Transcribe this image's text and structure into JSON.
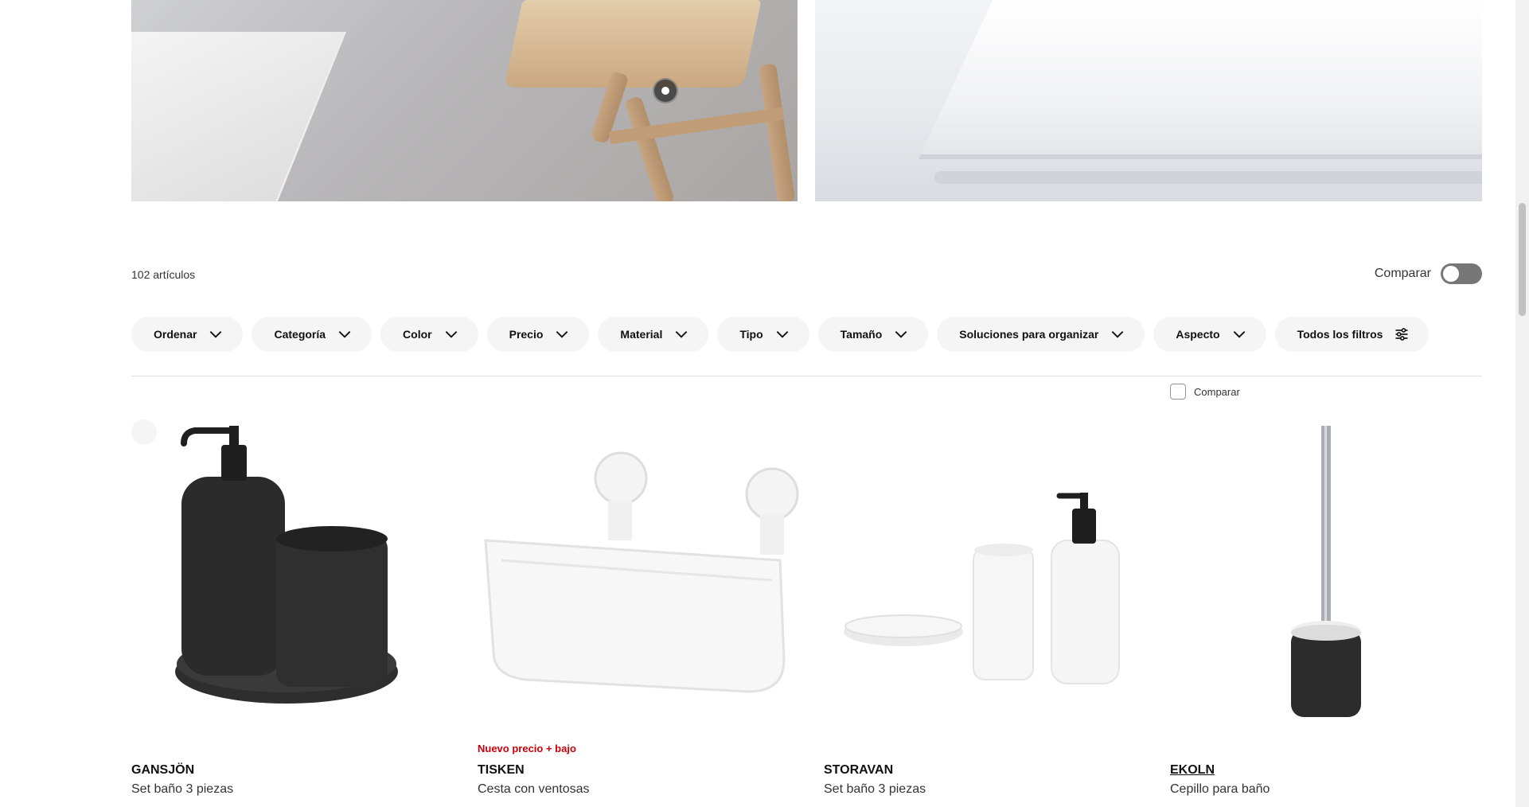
{
  "listing": {
    "count_label": "102 artículos",
    "compare_label": "Comparar"
  },
  "filters": [
    {
      "label": "Ordenar",
      "icon": "chevron-down-icon"
    },
    {
      "label": "Categoría",
      "icon": "chevron-down-icon"
    },
    {
      "label": "Color",
      "icon": "chevron-down-icon"
    },
    {
      "label": "Precio",
      "icon": "chevron-down-icon"
    },
    {
      "label": "Material",
      "icon": "chevron-down-icon"
    },
    {
      "label": "Tipo",
      "icon": "chevron-down-icon"
    },
    {
      "label": "Tamaño",
      "icon": "chevron-down-icon"
    },
    {
      "label": "Soluciones para organizar",
      "icon": "chevron-down-icon"
    },
    {
      "label": "Aspecto",
      "icon": "chevron-down-icon"
    },
    {
      "label": "Todos los filtros",
      "icon": "sliders-icon"
    }
  ],
  "products": [
    {
      "name": "GANSJÖN",
      "description": "Set baño 3 piezas",
      "badge": ""
    },
    {
      "name": "TISKEN",
      "description": "Cesta con ventosas",
      "badge": "Nuevo precio + bajo"
    },
    {
      "name": "STORAVAN",
      "description": "Set baño 3 piezas",
      "badge": ""
    },
    {
      "name": "EKOLN",
      "description": "Cepillo para baño",
      "badge": "",
      "compare_label": "Comparar"
    }
  ],
  "colors": {
    "pill_bg": "#f5f5f5",
    "badge_red": "#cc0008",
    "toggle_off": "#767676"
  }
}
